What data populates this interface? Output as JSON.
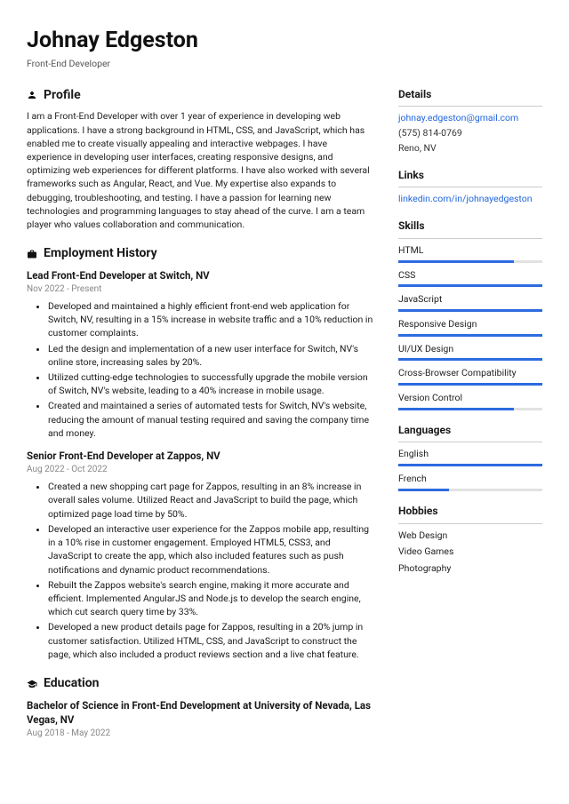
{
  "header": {
    "name": "Johnay Edgeston",
    "title": "Front-End Developer"
  },
  "profile": {
    "heading": "Profile",
    "text": "I am a Front-End Developer with over 1 year of experience in developing web applications. I have a strong background in HTML, CSS, and JavaScript, which has enabled me to create visually appealing and interactive webpages. I have experience in developing user interfaces, creating responsive designs, and optimizing web experiences for different platforms. I have also worked with several frameworks such as Angular, React, and Vue. My expertise also expands to debugging, troubleshooting, and testing. I have a passion for learning new technologies and programming languages to stay ahead of the curve. I am a team player who values collaboration and communication."
  },
  "employment": {
    "heading": "Employment History",
    "jobs": [
      {
        "title": "Lead Front-End Developer at Switch, NV",
        "dates": "Nov 2022 - Present",
        "bullets": [
          "Developed and maintained a highly efficient front-end web application for Switch, NV, resulting in a 15% increase in website traffic and a 10% reduction in customer complaints.",
          "Led the design and implementation of a new user interface for Switch, NV's online store, increasing sales by 20%.",
          "Utilized cutting-edge technologies to successfully upgrade the mobile version of Switch, NV's website, leading to a 40% increase in mobile usage.",
          "Created and maintained a series of automated tests for Switch, NV's website, reducing the amount of manual testing required and saving the company time and money."
        ]
      },
      {
        "title": "Senior Front-End Developer at Zappos, NV",
        "dates": "Aug 2022 - Oct 2022",
        "bullets": [
          "Created a new shopping cart page for Zappos, resulting in an 8% increase in overall sales volume. Utilized React and JavaScript to build the page, which optimized page load time by 50%.",
          "Developed an interactive user experience for the Zappos mobile app, resulting in a 10% rise in customer engagement. Employed HTML5, CSS3, and JavaScript to create the app, which also included features such as push notifications and dynamic product recommendations.",
          "Rebuilt the Zappos website's search engine, making it more accurate and efficient. Implemented AngularJS and Node.js to develop the search engine, which cut search query time by 33%.",
          "Developed a new product details page for Zappos, resulting in a 20% jump in customer satisfaction. Utilized HTML, CSS, and JavaScript to construct the page, which also included a product reviews section and a live chat feature."
        ]
      }
    ]
  },
  "education": {
    "heading": "Education",
    "degree": "Bachelor of Science in Front-End Development at University of Nevada, Las Vegas, NV",
    "dates": "Aug 2018 - May 2022"
  },
  "details": {
    "heading": "Details",
    "email": "johnay.edgeston@gmail.com",
    "phone": "(575) 814-0769",
    "location": "Reno, NV"
  },
  "links": {
    "heading": "Links",
    "url": "linkedin.com/in/johnayedgeston"
  },
  "skills": {
    "heading": "Skills",
    "items": [
      {
        "name": "HTML",
        "level": 80
      },
      {
        "name": "CSS",
        "level": 100
      },
      {
        "name": "JavaScript",
        "level": 100
      },
      {
        "name": "Responsive Design",
        "level": 100
      },
      {
        "name": "UI/UX Design",
        "level": 100
      },
      {
        "name": "Cross-Browser Compatibility",
        "level": 100
      },
      {
        "name": "Version Control",
        "level": 80
      }
    ]
  },
  "languages": {
    "heading": "Languages",
    "items": [
      {
        "name": "English",
        "level": 100
      },
      {
        "name": "French",
        "level": 35
      }
    ]
  },
  "hobbies": {
    "heading": "Hobbies",
    "items": [
      "Web Design",
      "Video Games",
      "Photography"
    ]
  }
}
